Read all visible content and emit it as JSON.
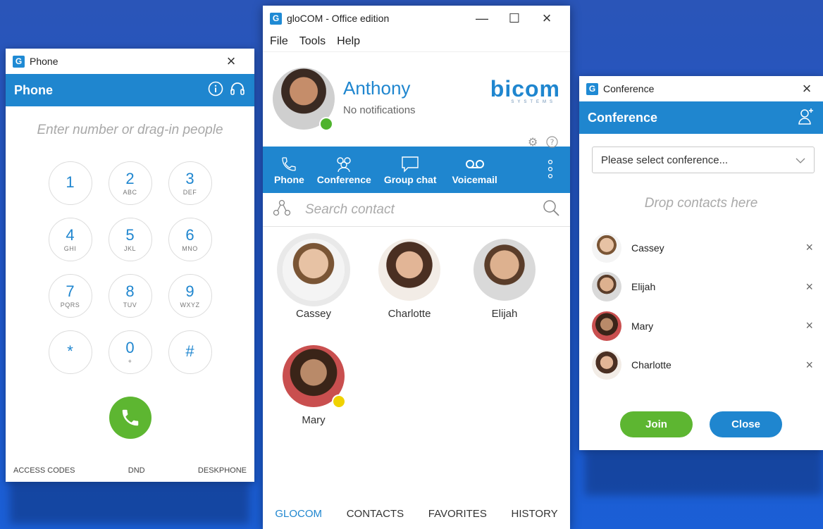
{
  "colors": {
    "accent": "#1f86cf",
    "call_green": "#5db631",
    "online": "#4fb32d",
    "away": "#f0d200",
    "desktop": "#1f56c8"
  },
  "phone": {
    "window_title": "Phone",
    "header": "Phone",
    "input_placeholder": "Enter number or drag-in people",
    "keys": [
      {
        "digit": "1",
        "letters": ""
      },
      {
        "digit": "2",
        "letters": "ABC"
      },
      {
        "digit": "3",
        "letters": "DEF"
      },
      {
        "digit": "4",
        "letters": "GHI"
      },
      {
        "digit": "5",
        "letters": "JKL"
      },
      {
        "digit": "6",
        "letters": "MNO"
      },
      {
        "digit": "7",
        "letters": "PQRS"
      },
      {
        "digit": "8",
        "letters": "TUV"
      },
      {
        "digit": "9",
        "letters": "WXYZ"
      },
      {
        "digit": "*",
        "letters": ""
      },
      {
        "digit": "0",
        "letters": "+"
      },
      {
        "digit": "#",
        "letters": ""
      }
    ],
    "footer": {
      "access_codes": "ACCESS CODES",
      "dnd": "DND",
      "deskphone": "DESKPHONE"
    }
  },
  "main": {
    "window_title": "gloCOM - Office edition",
    "menu": {
      "file": "File",
      "tools": "Tools",
      "help": "Help"
    },
    "user": {
      "name": "Anthony",
      "status": "No notifications",
      "presence": "online"
    },
    "brand": {
      "name": "bicom",
      "sub": "SYSTEMS"
    },
    "tabs": {
      "phone": "Phone",
      "conference": "Conference",
      "group_chat": "Group chat",
      "voicemail": "Voicemail"
    },
    "search_placeholder": "Search contact",
    "contacts": [
      {
        "name": "Cassey",
        "selected": true,
        "presence": ""
      },
      {
        "name": "Charlotte",
        "selected": false,
        "presence": ""
      },
      {
        "name": "Elijah",
        "selected": false,
        "presence": ""
      },
      {
        "name": "Mary",
        "selected": false,
        "presence": "away"
      }
    ],
    "bottom_tabs": {
      "glocom": "GLOCOM",
      "contacts": "CONTACTS",
      "favorites": "FAVORITES",
      "history": "HISTORY"
    },
    "active_bottom_tab": "GLOCOM"
  },
  "conference": {
    "window_title": "Conference",
    "header": "Conference",
    "select_placeholder": "Please select conference...",
    "drop_hint": "Drop contacts here",
    "participants": [
      {
        "name": "Cassey"
      },
      {
        "name": "Elijah"
      },
      {
        "name": "Mary"
      },
      {
        "name": "Charlotte"
      }
    ],
    "join_label": "Join",
    "close_label": "Close"
  }
}
